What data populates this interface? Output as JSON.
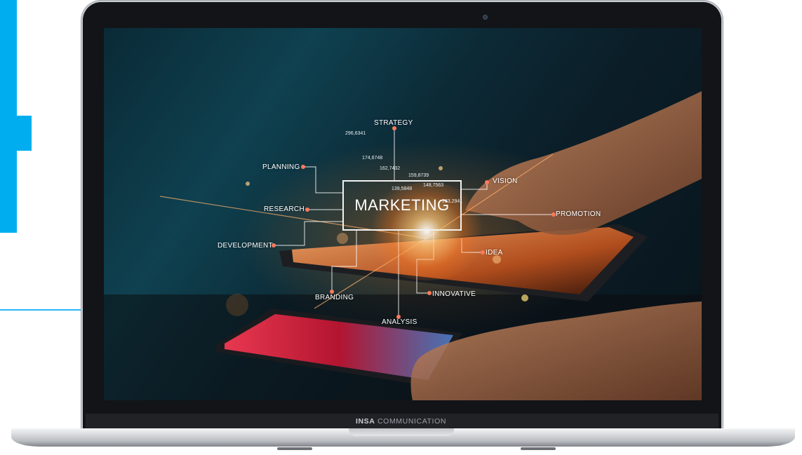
{
  "brand": {
    "bold": "INSA",
    "rest": " COMMUNICATION"
  },
  "mindmap": {
    "center": "MARKETING",
    "labels": {
      "strategy": "STRATEGY",
      "planning": "PLANNING",
      "research": "RESEARCH",
      "development": "DEVELOPMENT",
      "branding": "BRANDING",
      "analysis": "ANALYSIS",
      "innovative": "INNOVATIVE",
      "idea": "IDEA",
      "promotion": "PROMOTION",
      "vision": "VISION"
    },
    "numbers": [
      "296,6341",
      "174,6748",
      "162,7432",
      "159,8739",
      "139,5848",
      "148,7563",
      "283,2941"
    ]
  },
  "colors": {
    "accent_blue": "#00aeef",
    "glow_orange": "#ff8a28"
  },
  "icons": {
    "camera": "camera-icon"
  }
}
